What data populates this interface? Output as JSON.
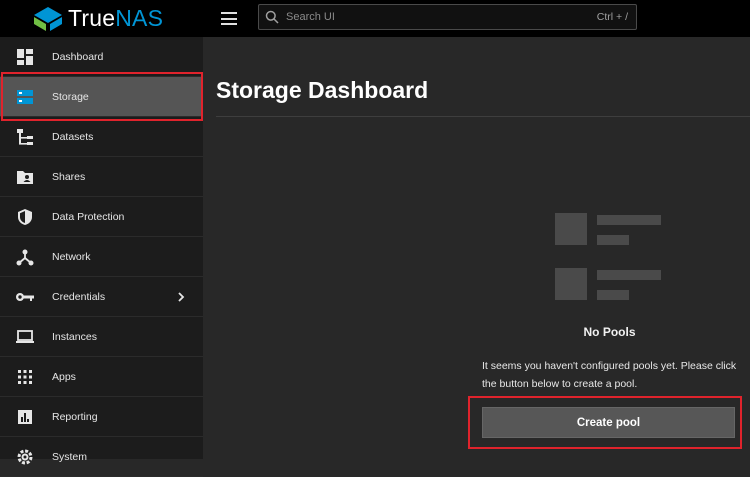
{
  "app": {
    "logo_text_a": "True",
    "logo_text_b": "NAS"
  },
  "search": {
    "placeholder": "Search UI",
    "shortcut": "Ctrl + /"
  },
  "sidebar": {
    "items": [
      {
        "label": "Dashboard",
        "icon": "dashboard-icon"
      },
      {
        "label": "Storage",
        "icon": "storage-icon",
        "active": true
      },
      {
        "label": "Datasets",
        "icon": "datasets-icon"
      },
      {
        "label": "Shares",
        "icon": "shares-icon"
      },
      {
        "label": "Data Protection",
        "icon": "shield-icon"
      },
      {
        "label": "Network",
        "icon": "network-icon"
      },
      {
        "label": "Credentials",
        "icon": "key-icon",
        "has_submenu": true
      },
      {
        "label": "Instances",
        "icon": "laptop-icon"
      },
      {
        "label": "Apps",
        "icon": "apps-grid-icon"
      },
      {
        "label": "Reporting",
        "icon": "chart-icon"
      },
      {
        "label": "System",
        "icon": "gear-icon"
      }
    ]
  },
  "main": {
    "title": "Storage Dashboard",
    "empty_title": "No Pools",
    "empty_message": "It seems you haven't configured pools yet. Please click the button below to create a pool.",
    "create_button": "Create pool"
  },
  "colors": {
    "accent": "#0095d5",
    "highlight": "#e0232c",
    "sidebar_bg": "#1c1c1c",
    "main_bg": "#282828"
  }
}
